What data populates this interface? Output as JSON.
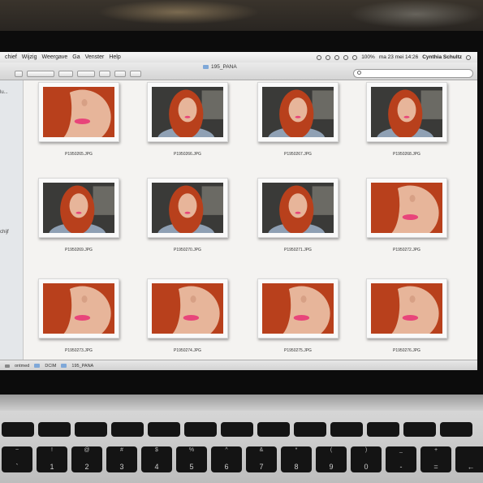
{
  "menubar": {
    "items": [
      "chief",
      "Wijzig",
      "Weergave",
      "Ga",
      "Venster",
      "Help"
    ],
    "battery": "100%",
    "clock": "ma 23 mei  14:26",
    "user": "Cynthia Schultz"
  },
  "window": {
    "title": "195_PANA"
  },
  "sidebar": {
    "labels": [
      "lu...",
      "chijf"
    ]
  },
  "files": [
    {
      "name": "P1950265.JPG",
      "variant": "closeup"
    },
    {
      "name": "P1950266.JPG",
      "variant": "full"
    },
    {
      "name": "P1950267.JPG",
      "variant": "full"
    },
    {
      "name": "P1950268.JPG",
      "variant": "full"
    },
    {
      "name": "P1950269.JPG",
      "variant": "full"
    },
    {
      "name": "P1950270.JPG",
      "variant": "full"
    },
    {
      "name": "P1950271.JPG",
      "variant": "full"
    },
    {
      "name": "P1950272.JPG",
      "variant": "closeup"
    },
    {
      "name": "P1950273.JPG",
      "variant": "closeup"
    },
    {
      "name": "P1950274.JPG",
      "variant": "closeup"
    },
    {
      "name": "P1950275.JPG",
      "variant": "closeup"
    },
    {
      "name": "P1950276.JPG",
      "variant": "closeup"
    }
  ],
  "pathbar": {
    "items": [
      "ontmed",
      "DCIM",
      "195_PANA"
    ]
  },
  "keyboard": {
    "row1": [
      {
        "main": "`",
        "sub": "~"
      },
      {
        "main": "1",
        "sub": "!"
      },
      {
        "main": "2",
        "sub": "@"
      },
      {
        "main": "3",
        "sub": "#"
      },
      {
        "main": "4",
        "sub": "$"
      },
      {
        "main": "5",
        "sub": "%"
      },
      {
        "main": "6",
        "sub": "^"
      },
      {
        "main": "7",
        "sub": "&"
      },
      {
        "main": "8",
        "sub": "*"
      },
      {
        "main": "9",
        "sub": "("
      },
      {
        "main": "0",
        "sub": ")"
      },
      {
        "main": "-",
        "sub": "_"
      },
      {
        "main": "=",
        "sub": "+"
      },
      {
        "main": "←",
        "sub": ""
      }
    ]
  },
  "colors": {
    "hair": "#b8401c",
    "skin": "#e7b59a",
    "lips": "#e8457a",
    "backdrop": "#3a3a38"
  }
}
